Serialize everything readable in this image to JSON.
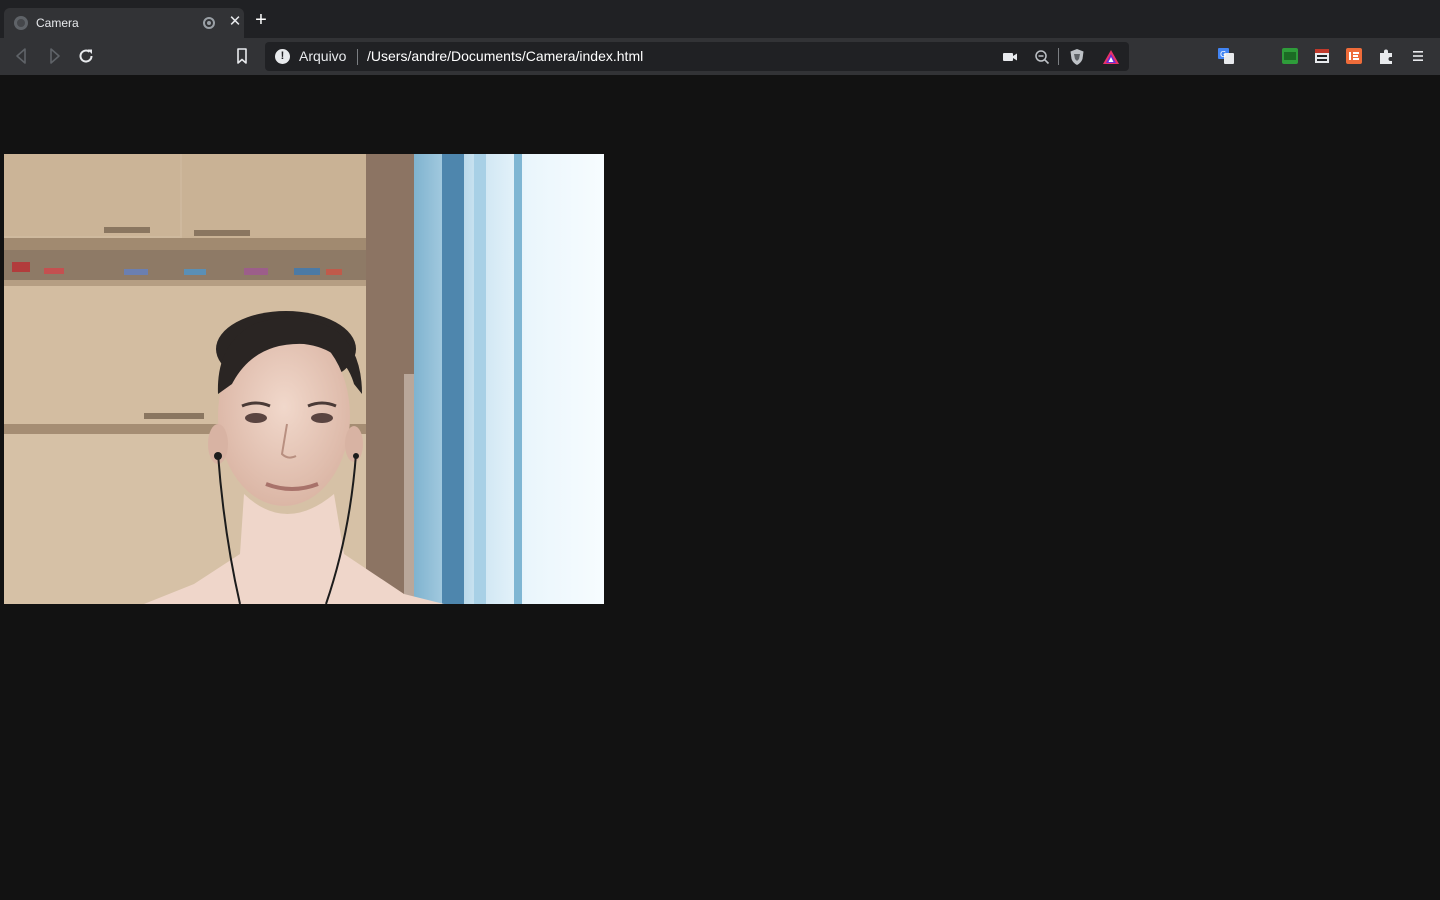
{
  "tab": {
    "title": "Camera"
  },
  "toolbar": {
    "security_label": "Arquivo",
    "url": "/Users/andre/Documents/Camera/index.html"
  },
  "icons": {
    "back": "back-arrow-icon",
    "forward": "forward-arrow-icon",
    "reload": "reload-icon",
    "bookmark": "bookmark-icon",
    "info": "info-icon",
    "camera_in_use": "video-camera-icon",
    "zoom": "zoom-out-icon",
    "shields": "brave-shields-icon",
    "rewards": "brave-rewards-icon",
    "translate": "translate-icon",
    "extensions_menu": "puzzle-icon",
    "menu": "hamburger-menu-icon"
  },
  "colors": {
    "page_background": "#121212",
    "toolbar": "#323336",
    "tabstrip": "#202124",
    "omnibox": "#202124"
  }
}
